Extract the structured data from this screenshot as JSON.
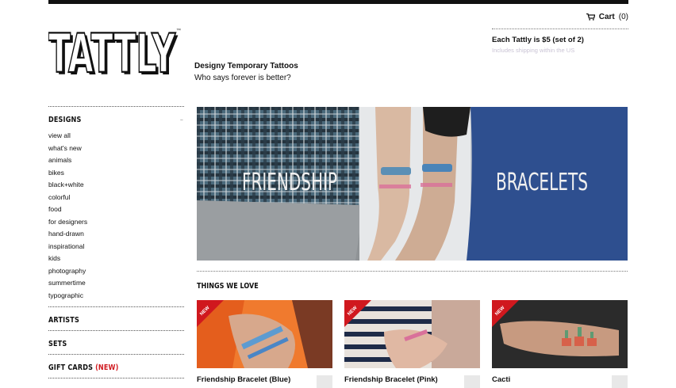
{
  "header": {
    "cart_label": "Cart",
    "cart_count": "(0)",
    "logo_text": "TATTLY",
    "trademark": "™",
    "tagline": "Designy Temporary Tattoos",
    "tagline_sub": "Who says forever is better?",
    "price": "Each Tattly is $5 (set of 2)",
    "shipping": "Includes shipping within the US"
  },
  "sidebar": {
    "designs_title": "DESIGNS",
    "designs_toggle": "–",
    "designs": [
      "view all",
      "what's new",
      "animals",
      "bikes",
      "black+white",
      "colorful",
      "food",
      "for designers",
      "hand-drawn",
      "inspirational",
      "kids",
      "photography",
      "summertime",
      "typographic"
    ],
    "artists_title": "ARTISTS",
    "sets_title": "SETS",
    "giftcards_title": "GIFT CARDS",
    "giftcards_new": "(NEW)"
  },
  "hero": {
    "left_word": "FRIENDSHIP",
    "right_word": "BRACELETS"
  },
  "things": {
    "title": "THINGS WE LOVE",
    "products": [
      {
        "name": "Friendship Bracelet (Blue)",
        "badge": "NEW"
      },
      {
        "name": "Friendship Bracelet (Pink)",
        "badge": "NEW"
      },
      {
        "name": "Cacti",
        "badge": "NEW"
      }
    ]
  },
  "colors": {
    "accent_red": "#d0181e",
    "text": "#111111"
  }
}
